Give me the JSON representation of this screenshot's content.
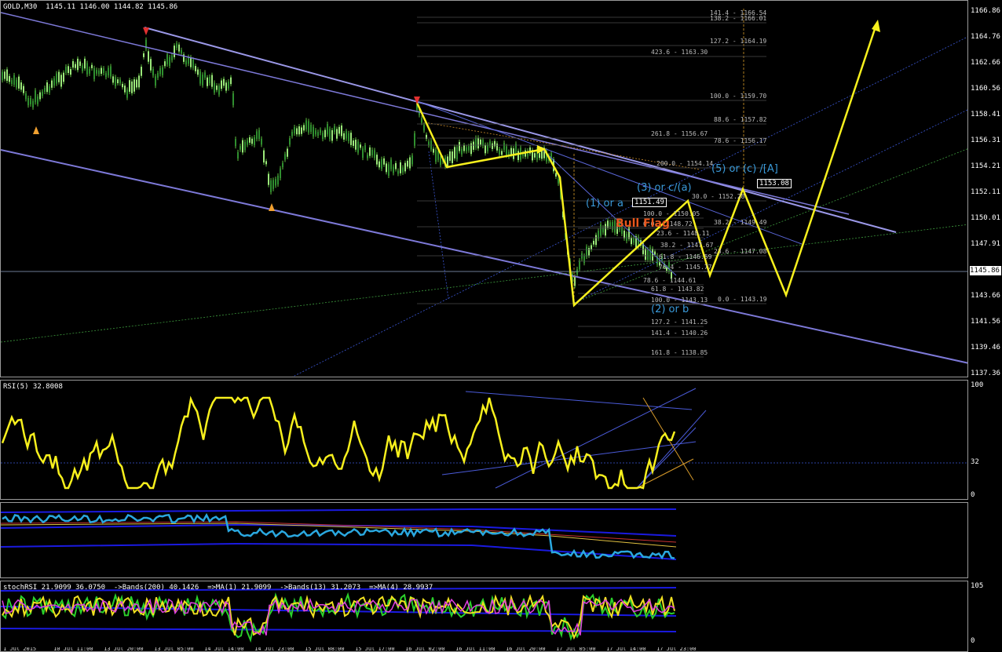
{
  "main": {
    "title": "GOLD,M30  1145.11 1146.00 1144.82 1145.86",
    "current_price": "1145.86",
    "price_axis": [
      "1166.86",
      "1164.76",
      "1162.66",
      "1160.56",
      "1158.41",
      "1156.31",
      "1154.21",
      "1152.11",
      "1150.01",
      "1147.91",
      "1145.81",
      "1143.66",
      "1141.56",
      "1139.46",
      "1137.36"
    ],
    "fib_upper": [
      "141.4 - 1166.54",
      "138.2 - 1166.01",
      "127.2 - 1164.19",
      "423.6 - 1163.30",
      "100.0 - 1159.70",
      "88.6 - 1157.82",
      "261.8 - 1156.67",
      "78.6 - 1156.17",
      "200.0 - 1154.14",
      "30.0 - 1152.28",
      "38.2 - 1149.49",
      "23.6 - 1147.08",
      "0.0 - 1143.19"
    ],
    "fib_lower": [
      "100.0 - 1143.13",
      "127.2 - 1141.25",
      "141.4 - 1140.26",
      "161.8 - 1138.85",
      "61.8 - 1143.82",
      "78.6 - 1144.61"
    ],
    "fib_inner": [
      "100.0 - 1150.05",
      "0.0 - 1148.72",
      "23.6 - 1148.11",
      "38.2 - 1147.67",
      "61.8 - 1146.59",
      "76.4 - 1145.77"
    ],
    "waves": {
      "w1": "(1) or a",
      "w2": "(2) or b",
      "w3": "(3) or c/(a)",
      "w5": "(5) or (c) /[A]"
    },
    "box_labels": [
      "1151.49",
      "1153.08"
    ],
    "pattern_label": "Bull Flag",
    "mini_counts": [
      "5",
      "3",
      "1",
      "3",
      "4",
      "2",
      "3"
    ]
  },
  "rsi": {
    "title": "RSI(5) 32.8008",
    "axis": [
      "100",
      "32",
      "0"
    ]
  },
  "stoch": {
    "title": "stochRSI 21.9099 36.0750  ->Bands(200) 40.1426  =>MA(1) 21.9099  ->Bands(13) 31.2073  =>MA(4) 28.9937",
    "axis": [
      "105",
      "0"
    ]
  },
  "time_axis": [
    "1 Jul 2015",
    "10 Jul 11:00",
    "13 Jul 20:00",
    "13 Jul 05:00",
    "14 Jul 14:00",
    "14 Jul 23:00",
    "15 Jul 08:00",
    "15 Jul 17:00",
    "16 Jul 02:00",
    "16 Jul 11:00",
    "16 Jul 20:00",
    "17 Jul 05:00",
    "17 Jul 14:00",
    "17 Jul 23:00"
  ],
  "colors": {
    "candle_up": "#7ddc5a",
    "candle_down": "#7ddc5a",
    "channel": "#8a86e6",
    "arrows": "#f7f01d",
    "rsi": "#f7f01d",
    "wave_label": "#3a9ad9",
    "bull_flag": "#e8561c"
  }
}
